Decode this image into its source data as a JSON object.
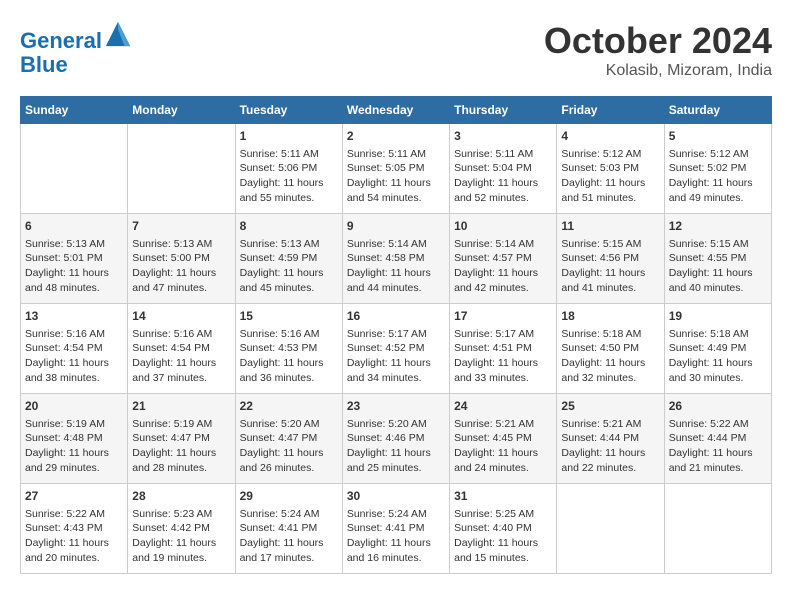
{
  "header": {
    "logo_line1": "General",
    "logo_line2": "Blue",
    "title": "October 2024",
    "subtitle": "Kolasib, Mizoram, India"
  },
  "days_of_week": [
    "Sunday",
    "Monday",
    "Tuesday",
    "Wednesday",
    "Thursday",
    "Friday",
    "Saturday"
  ],
  "weeks": [
    [
      {
        "day": "",
        "info": ""
      },
      {
        "day": "",
        "info": ""
      },
      {
        "day": "1",
        "info": "Sunrise: 5:11 AM\nSunset: 5:06 PM\nDaylight: 11 hours\nand 55 minutes."
      },
      {
        "day": "2",
        "info": "Sunrise: 5:11 AM\nSunset: 5:05 PM\nDaylight: 11 hours\nand 54 minutes."
      },
      {
        "day": "3",
        "info": "Sunrise: 5:11 AM\nSunset: 5:04 PM\nDaylight: 11 hours\nand 52 minutes."
      },
      {
        "day": "4",
        "info": "Sunrise: 5:12 AM\nSunset: 5:03 PM\nDaylight: 11 hours\nand 51 minutes."
      },
      {
        "day": "5",
        "info": "Sunrise: 5:12 AM\nSunset: 5:02 PM\nDaylight: 11 hours\nand 49 minutes."
      }
    ],
    [
      {
        "day": "6",
        "info": "Sunrise: 5:13 AM\nSunset: 5:01 PM\nDaylight: 11 hours\nand 48 minutes."
      },
      {
        "day": "7",
        "info": "Sunrise: 5:13 AM\nSunset: 5:00 PM\nDaylight: 11 hours\nand 47 minutes."
      },
      {
        "day": "8",
        "info": "Sunrise: 5:13 AM\nSunset: 4:59 PM\nDaylight: 11 hours\nand 45 minutes."
      },
      {
        "day": "9",
        "info": "Sunrise: 5:14 AM\nSunset: 4:58 PM\nDaylight: 11 hours\nand 44 minutes."
      },
      {
        "day": "10",
        "info": "Sunrise: 5:14 AM\nSunset: 4:57 PM\nDaylight: 11 hours\nand 42 minutes."
      },
      {
        "day": "11",
        "info": "Sunrise: 5:15 AM\nSunset: 4:56 PM\nDaylight: 11 hours\nand 41 minutes."
      },
      {
        "day": "12",
        "info": "Sunrise: 5:15 AM\nSunset: 4:55 PM\nDaylight: 11 hours\nand 40 minutes."
      }
    ],
    [
      {
        "day": "13",
        "info": "Sunrise: 5:16 AM\nSunset: 4:54 PM\nDaylight: 11 hours\nand 38 minutes."
      },
      {
        "day": "14",
        "info": "Sunrise: 5:16 AM\nSunset: 4:54 PM\nDaylight: 11 hours\nand 37 minutes."
      },
      {
        "day": "15",
        "info": "Sunrise: 5:16 AM\nSunset: 4:53 PM\nDaylight: 11 hours\nand 36 minutes."
      },
      {
        "day": "16",
        "info": "Sunrise: 5:17 AM\nSunset: 4:52 PM\nDaylight: 11 hours\nand 34 minutes."
      },
      {
        "day": "17",
        "info": "Sunrise: 5:17 AM\nSunset: 4:51 PM\nDaylight: 11 hours\nand 33 minutes."
      },
      {
        "day": "18",
        "info": "Sunrise: 5:18 AM\nSunset: 4:50 PM\nDaylight: 11 hours\nand 32 minutes."
      },
      {
        "day": "19",
        "info": "Sunrise: 5:18 AM\nSunset: 4:49 PM\nDaylight: 11 hours\nand 30 minutes."
      }
    ],
    [
      {
        "day": "20",
        "info": "Sunrise: 5:19 AM\nSunset: 4:48 PM\nDaylight: 11 hours\nand 29 minutes."
      },
      {
        "day": "21",
        "info": "Sunrise: 5:19 AM\nSunset: 4:47 PM\nDaylight: 11 hours\nand 28 minutes."
      },
      {
        "day": "22",
        "info": "Sunrise: 5:20 AM\nSunset: 4:47 PM\nDaylight: 11 hours\nand 26 minutes."
      },
      {
        "day": "23",
        "info": "Sunrise: 5:20 AM\nSunset: 4:46 PM\nDaylight: 11 hours\nand 25 minutes."
      },
      {
        "day": "24",
        "info": "Sunrise: 5:21 AM\nSunset: 4:45 PM\nDaylight: 11 hours\nand 24 minutes."
      },
      {
        "day": "25",
        "info": "Sunrise: 5:21 AM\nSunset: 4:44 PM\nDaylight: 11 hours\nand 22 minutes."
      },
      {
        "day": "26",
        "info": "Sunrise: 5:22 AM\nSunset: 4:44 PM\nDaylight: 11 hours\nand 21 minutes."
      }
    ],
    [
      {
        "day": "27",
        "info": "Sunrise: 5:22 AM\nSunset: 4:43 PM\nDaylight: 11 hours\nand 20 minutes."
      },
      {
        "day": "28",
        "info": "Sunrise: 5:23 AM\nSunset: 4:42 PM\nDaylight: 11 hours\nand 19 minutes."
      },
      {
        "day": "29",
        "info": "Sunrise: 5:24 AM\nSunset: 4:41 PM\nDaylight: 11 hours\nand 17 minutes."
      },
      {
        "day": "30",
        "info": "Sunrise: 5:24 AM\nSunset: 4:41 PM\nDaylight: 11 hours\nand 16 minutes."
      },
      {
        "day": "31",
        "info": "Sunrise: 5:25 AM\nSunset: 4:40 PM\nDaylight: 11 hours\nand 15 minutes."
      },
      {
        "day": "",
        "info": ""
      },
      {
        "day": "",
        "info": ""
      }
    ]
  ]
}
